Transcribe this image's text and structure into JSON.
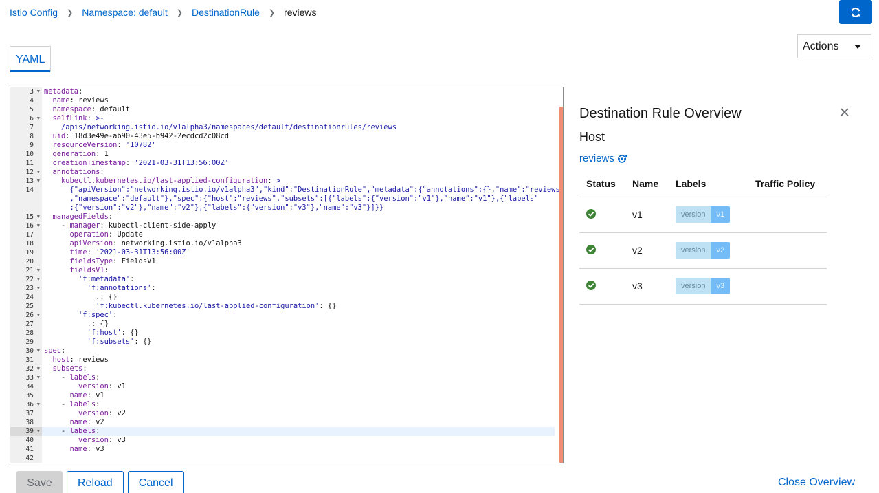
{
  "breadcrumb": {
    "items": [
      "Istio Config",
      "Namespace: default",
      "DestinationRule"
    ],
    "current": "reviews"
  },
  "header": {
    "actions_label": "Actions",
    "refresh_icon": "refresh-icon"
  },
  "tabs": [
    {
      "label": "YAML"
    }
  ],
  "editor": {
    "active_line": 39,
    "lines": [
      {
        "n": 3,
        "fold": true,
        "code": "<span class=\"k\">metadata</span>:"
      },
      {
        "n": 4,
        "code": "  <span class=\"k\">name</span>: reviews"
      },
      {
        "n": 5,
        "code": "  <span class=\"k\">namespace</span>: default"
      },
      {
        "n": 6,
        "fold": true,
        "code": "  <span class=\"k\">selfLink</span>: <span class=\"s\">&gt;-</span>"
      },
      {
        "n": 7,
        "code": "    <span class=\"s\">/apis/networking.istio.io/v1alpha3/namespaces/default/destinationrules/reviews</span>"
      },
      {
        "n": 8,
        "code": "  <span class=\"k\">uid</span>: 18d3e49e-ab90-43e5-b942-2ecdcd2c08cd"
      },
      {
        "n": 9,
        "code": "  <span class=\"k\">resourceVersion</span>: <span class=\"s\">'10782'</span>"
      },
      {
        "n": 10,
        "code": "  <span class=\"k\">generation</span>: 1"
      },
      {
        "n": 11,
        "code": "  <span class=\"k\">creationTimestamp</span>: <span class=\"s\">'2021-03-31T13:56:00Z'</span>"
      },
      {
        "n": 12,
        "fold": true,
        "code": "  <span class=\"k\">annotations</span>:"
      },
      {
        "n": 13,
        "fold": true,
        "code": "    <span class=\"k\">kubectl.kubernetes.io/last-applied-configuration</span>: <span class=\"s\">&gt;</span>"
      },
      {
        "n": 14,
        "code": "      <span class=\"s\">{\"apiVersion\":\"networking.istio.io/v1alpha3\",\"kind\":\"DestinationRule\",\"metadata\":{\"annotations\":{},\"name\":\"reviews\"</span>"
      },
      {
        "n": "",
        "code": "      <span class=\"s\">,\"namespace\":\"default\"},\"spec\":{\"host\":\"reviews\",\"subsets\":[{\"labels\":{\"version\":\"v1\"},\"name\":\"v1\"},{\"labels\"</span>"
      },
      {
        "n": "",
        "code": "      <span class=\"s\">:{\"version\":\"v2\"},\"name\":\"v2\"},{\"labels\":{\"version\":\"v3\"},\"name\":\"v3\"}]}}</span>"
      },
      {
        "n": 15,
        "fold": true,
        "code": "  <span class=\"k\">managedFields</span>:"
      },
      {
        "n": 16,
        "fold": true,
        "code": "    - <span class=\"k\">manager</span>: kubectl-client-side-apply"
      },
      {
        "n": 17,
        "code": "      <span class=\"k\">operation</span>: Update"
      },
      {
        "n": 18,
        "code": "      <span class=\"k\">apiVersion</span>: networking.istio.io/v1alpha3"
      },
      {
        "n": 19,
        "code": "      <span class=\"k\">time</span>: <span class=\"s\">'2021-03-31T13:56:00Z'</span>"
      },
      {
        "n": 20,
        "code": "      <span class=\"k\">fieldsType</span>: FieldsV1"
      },
      {
        "n": 21,
        "fold": true,
        "code": "      <span class=\"k\">fieldsV1</span>:"
      },
      {
        "n": 22,
        "fold": true,
        "code": "        <span class=\"s\">'f:metadata'</span>:"
      },
      {
        "n": 23,
        "fold": true,
        "code": "          <span class=\"s\">'f:annotations'</span>:"
      },
      {
        "n": 24,
        "code": "            .: {}"
      },
      {
        "n": 25,
        "code": "            <span class=\"s\">'f:kubectl.kubernetes.io/last-applied-configuration'</span>: {}"
      },
      {
        "n": 26,
        "fold": true,
        "code": "        <span class=\"s\">'f:spec'</span>:"
      },
      {
        "n": 27,
        "code": "          .: {}"
      },
      {
        "n": 28,
        "code": "          <span class=\"s\">'f:host'</span>: {}"
      },
      {
        "n": 29,
        "code": "          <span class=\"s\">'f:subsets'</span>: {}"
      },
      {
        "n": 30,
        "fold": true,
        "code": "<span class=\"k\">spec</span>:"
      },
      {
        "n": 31,
        "code": "  <span class=\"k\">host</span>: reviews"
      },
      {
        "n": 32,
        "fold": true,
        "code": "  <span class=\"k\">subsets</span>:"
      },
      {
        "n": 33,
        "fold": true,
        "code": "    - <span class=\"k\">labels</span>:"
      },
      {
        "n": 34,
        "code": "        <span class=\"k\">version</span>: v1"
      },
      {
        "n": 35,
        "code": "      <span class=\"k\">name</span>: v1"
      },
      {
        "n": 36,
        "fold": true,
        "code": "    - <span class=\"k\">labels</span>:"
      },
      {
        "n": 37,
        "code": "        <span class=\"k\">version</span>: v2"
      },
      {
        "n": 38,
        "code": "      <span class=\"k\">name</span>: v2"
      },
      {
        "n": 39,
        "fold": true,
        "code": "    - <span class=\"k\">labels</span>:"
      },
      {
        "n": 40,
        "code": "        <span class=\"k\">version</span>: v3"
      },
      {
        "n": 41,
        "code": "      <span class=\"k\">name</span>: v3"
      },
      {
        "n": 42,
        "code": ""
      }
    ]
  },
  "overview": {
    "title": "Destination Rule Overview",
    "host_label": "Host",
    "host_value": "reviews",
    "columns": [
      "Status",
      "Name",
      "Labels",
      "Traffic Policy"
    ],
    "rows": [
      {
        "name": "v1",
        "label_key": "version",
        "label_value": "v1",
        "status": "ok"
      },
      {
        "name": "v2",
        "label_key": "version",
        "label_value": "v2",
        "status": "ok"
      },
      {
        "name": "v3",
        "label_key": "version",
        "label_value": "v3",
        "status": "ok"
      }
    ]
  },
  "footer": {
    "save_label": "Save",
    "reload_label": "Reload",
    "cancel_label": "Cancel",
    "close_overview_label": "Close Overview"
  },
  "colors": {
    "link": "#0066cc",
    "status_ok": "#3e8635",
    "label_key_bg": "#bee1f4",
    "label_value_bg": "#73bcf7",
    "editor_scrollbar": "#ee8e72"
  }
}
